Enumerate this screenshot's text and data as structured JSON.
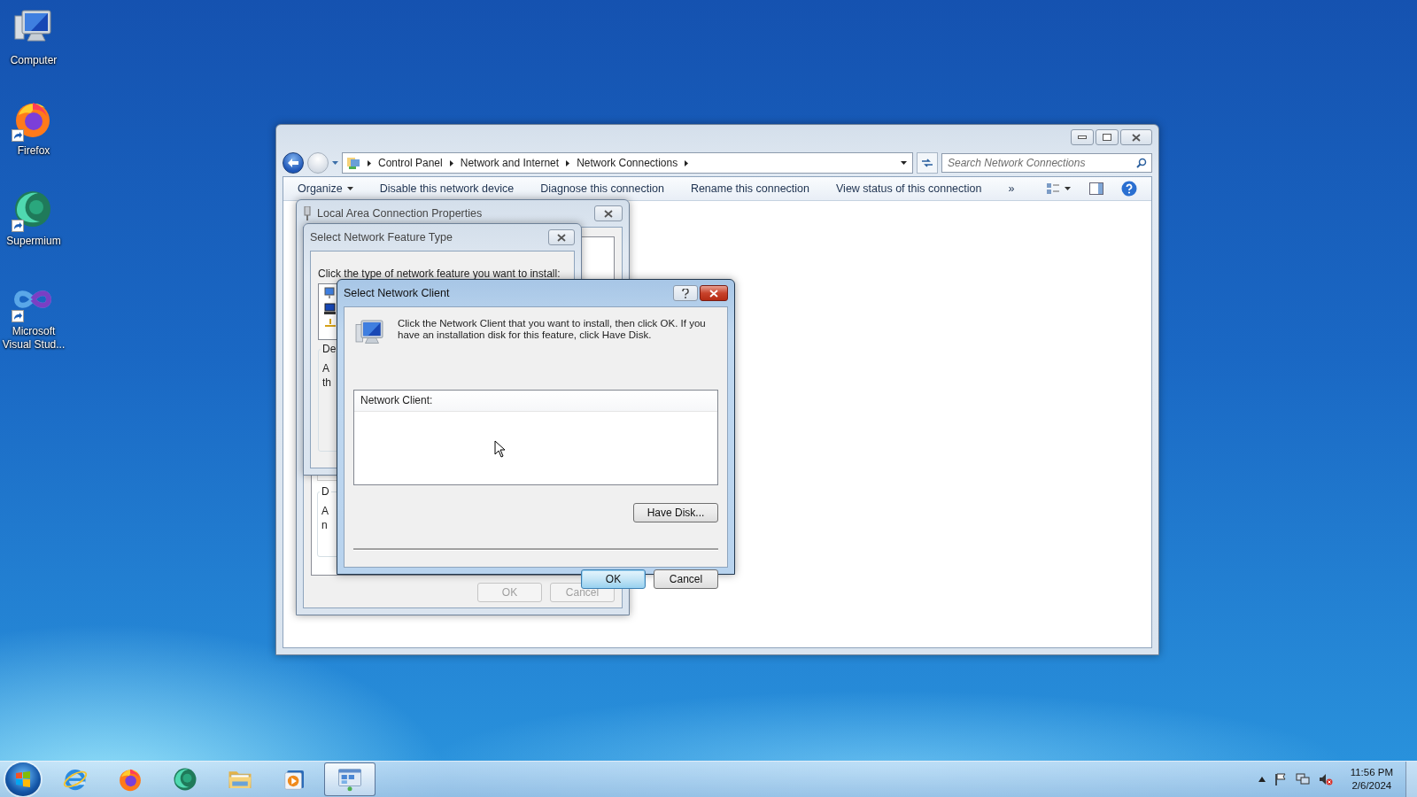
{
  "desktop_icons": [
    {
      "label": "Computer",
      "kind": "computer"
    },
    {
      "label": "Firefox",
      "kind": "firefox",
      "shortcut": true
    },
    {
      "label": "Supermium",
      "kind": "supermium",
      "shortcut": true
    },
    {
      "label": "Microsoft Visual Stud...",
      "kind": "visual-studio",
      "shortcut": true
    }
  ],
  "explorer": {
    "breadcrumb": [
      "Control Panel",
      "Network and Internet",
      "Network Connections"
    ],
    "search": {
      "placeholder": "Search Network Connections"
    },
    "toolbar": [
      {
        "label": "Organize",
        "dropdown": true
      },
      {
        "label": "Disable this network device"
      },
      {
        "label": "Diagnose this connection"
      },
      {
        "label": "Rename this connection"
      },
      {
        "label": "View status of this connection"
      }
    ],
    "overflow": "»"
  },
  "properties_dialog": {
    "title": "Local Area Connection Properties",
    "group_label": "D",
    "group_lines": [
      "A",
      "n"
    ],
    "buttons": [
      {
        "label": "OK",
        "disabled": true
      },
      {
        "label": "Cancel",
        "disabled": true
      }
    ]
  },
  "feature_dialog": {
    "title": "Select Network Feature Type",
    "prompt": "Click the type of network feature you want to install:",
    "group_label": "De",
    "group_lines": [
      "A",
      "th"
    ]
  },
  "client_dialog": {
    "title": "Select Network Client",
    "message": "Click the Network Client that you want to install, then click OK. If you have an installation disk for this feature, click Have Disk.",
    "list_header": "Network Client:",
    "have_disk": "Have Disk...",
    "buttons": [
      {
        "label": "OK",
        "default": true
      },
      {
        "label": "Cancel",
        "default": false
      }
    ]
  },
  "taskbar": {
    "apps": [
      {
        "kind": "ie",
        "selected": false
      },
      {
        "kind": "firefox",
        "selected": false
      },
      {
        "kind": "supermium",
        "selected": false
      },
      {
        "kind": "folder",
        "selected": false
      },
      {
        "kind": "media",
        "selected": false
      },
      {
        "kind": "network",
        "selected": true
      }
    ],
    "time": "11:56 PM",
    "date": "2/6/2024"
  }
}
